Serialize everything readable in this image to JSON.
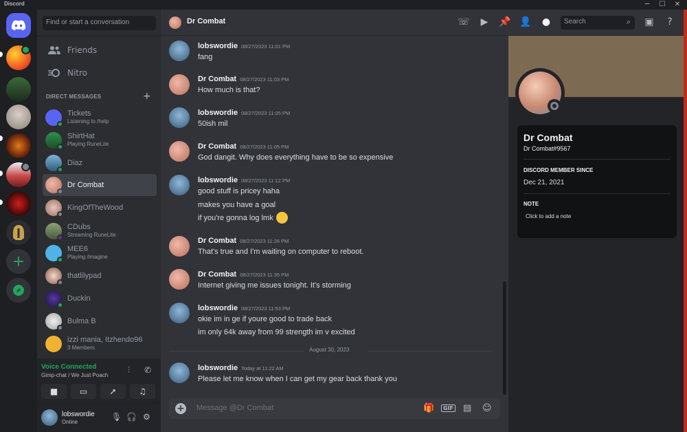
{
  "app": {
    "title": "Discord"
  },
  "window_controls": {
    "minimize": "─",
    "maximize": "☐",
    "close": "✕"
  },
  "sidebar": {
    "search_placeholder": "Find or start a conversation",
    "nav": [
      {
        "label": "Friends",
        "icon": "friends-icon"
      },
      {
        "label": "Nitro",
        "icon": "nitro-icon"
      }
    ],
    "direct_messages_header": "DIRECT MESSAGES",
    "add_dm": "+",
    "dms": [
      {
        "name": "Tickets",
        "sub": "Listening to /help"
      },
      {
        "name": "ShirtHat",
        "sub": "Playing RuneLite"
      },
      {
        "name": "Diaz",
        "sub": ""
      },
      {
        "name": "Dr Combat",
        "sub": ""
      },
      {
        "name": "KingOfTheWood",
        "sub": ""
      },
      {
        "name": "CDubs",
        "sub": "Streaming RuneLite"
      },
      {
        "name": "MEE6",
        "sub": "Playing /imagine"
      },
      {
        "name": "thatlilypad",
        "sub": ""
      },
      {
        "name": "Duckin",
        "sub": ""
      },
      {
        "name": "Bulma B",
        "sub": ""
      },
      {
        "name": "izzi mania, Itzhendo96",
        "sub": "3 Members"
      }
    ]
  },
  "voice": {
    "title": "Voice Connected",
    "channel": "Gimp-chat / We Just Poach"
  },
  "user": {
    "name": "lobswordie",
    "status": "Online"
  },
  "chat": {
    "header_name": "Dr Combat",
    "search_placeholder": "Search",
    "messages": [
      {
        "author": "lobswordie",
        "time": "08/27/2023 11:01 PM",
        "lines": [
          "fang"
        ]
      },
      {
        "author": "Dr Combat",
        "time": "08/27/2023 11:03 PM",
        "lines": [
          "How much is that?"
        ]
      },
      {
        "author": "lobswordie",
        "time": "08/27/2023 11:05 PM",
        "lines": [
          "50ish mil"
        ]
      },
      {
        "author": "Dr Combat",
        "time": "08/27/2023 11:05 PM",
        "lines": [
          "God dangit. Why does everything have to be so expensive"
        ]
      },
      {
        "author": "lobswordie",
        "time": "08/27/2023 11:12 PM",
        "lines": [
          "good stuff is pricey haha",
          "makes you have a goal",
          "if you're gonna log lmk"
        ]
      },
      {
        "author": "Dr Combat",
        "time": "08/27/2023 11:26 PM",
        "lines": [
          "That's true and I'm waiting on computer to reboot."
        ]
      },
      {
        "author": "Dr Combat",
        "time": "08/27/2023 11:35 PM",
        "lines": [
          "Internet giving me issues tonight. It's storming"
        ]
      },
      {
        "author": "lobswordie",
        "time": "08/27/2023 11:53 PM",
        "lines": [
          "okie im in ge if youre good to trade back",
          "im only 64k away from 99 strength im v excited"
        ]
      },
      {
        "author": "lobswordie",
        "time": "Today at 11:22 AM",
        "lines": [
          "Please let me know when I can get my gear back thank you"
        ]
      }
    ],
    "date_separator": "August 30, 2023",
    "composer_placeholder": "Message @Dr Combat"
  },
  "profile": {
    "display_name": "Dr Combat",
    "tag": "Dr Combat#9567",
    "member_since_label": "DISCORD MEMBER SINCE",
    "member_since": "Dec 21, 2021",
    "note_label": "NOTE",
    "note_placeholder": "Click to add a note"
  },
  "colors": {
    "online": "#23a55a",
    "accent": "#5865f2",
    "bg_main": "#313338",
    "bg_sidebar": "#2b2d31"
  }
}
